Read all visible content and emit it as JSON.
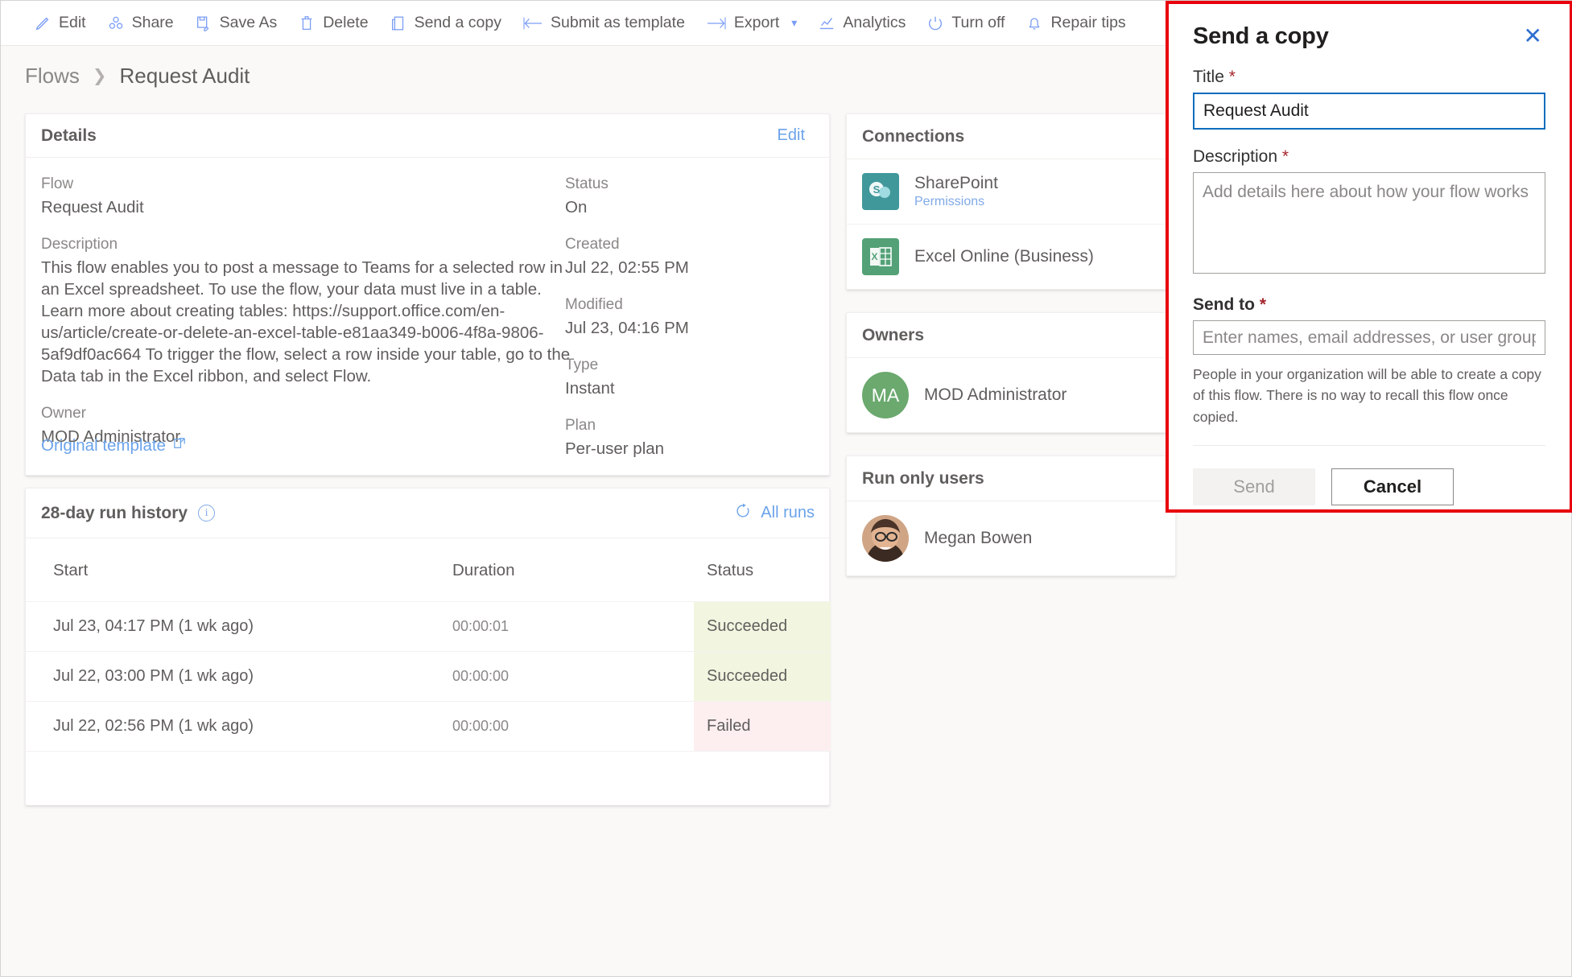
{
  "commandbar": {
    "items": [
      {
        "label": "Edit",
        "icon": "pencil-icon",
        "has_chevron": false
      },
      {
        "label": "Share",
        "icon": "share-icon",
        "has_chevron": false
      },
      {
        "label": "Save As",
        "icon": "save-as-icon",
        "has_chevron": false
      },
      {
        "label": "Delete",
        "icon": "trash-icon",
        "has_chevron": false
      },
      {
        "label": "Send a copy",
        "icon": "send-copy-icon",
        "has_chevron": false
      },
      {
        "label": "Submit as template",
        "icon": "submit-arrow-icon",
        "has_chevron": false
      },
      {
        "label": "Export",
        "icon": "export-arrow-icon",
        "has_chevron": true
      },
      {
        "label": "Analytics",
        "icon": "analytics-icon",
        "has_chevron": false
      },
      {
        "label": "Turn off",
        "icon": "power-icon",
        "has_chevron": false
      },
      {
        "label": "Repair tips",
        "icon": "bell-icon",
        "has_chevron": false
      }
    ]
  },
  "breadcrumb": {
    "parent": "Flows",
    "separator": "❯",
    "current": "Request Audit"
  },
  "details": {
    "title": "Details",
    "edit_label": "Edit",
    "left_fields": [
      {
        "label": "Flow",
        "value": "Request Audit"
      },
      {
        "label": "Description",
        "value": "This flow enables you to post a message to Teams for a selected row in an Excel spreadsheet. To use the flow, your data must live in a table. Learn more about creating tables: https://support.office.com/en-us/article/create-or-delete-an-excel-table-e81aa349-b006-4f8a-9806-5af9df0ac664 To trigger the flow, select a row inside your table, go to the Data tab in the Excel ribbon, and select Flow."
      },
      {
        "label": "Owner",
        "value": "MOD Administrator"
      }
    ],
    "right_fields": [
      {
        "label": "Status",
        "value": "On"
      },
      {
        "label": "Created",
        "value": "Jul 22, 02:55 PM"
      },
      {
        "label": "Modified",
        "value": "Jul 23, 04:16 PM"
      },
      {
        "label": "Type",
        "value": "Instant"
      },
      {
        "label": "Plan",
        "value": "Per-user plan"
      }
    ],
    "original_template_label": "Original template"
  },
  "run_history": {
    "title": "28-day run history",
    "info_glyph": "i",
    "all_runs_label": "All runs",
    "columns": [
      "Start",
      "Duration",
      "Status"
    ],
    "rows": [
      {
        "start": "Jul 23, 04:17 PM (1 wk ago)",
        "duration": "00:00:01",
        "status": "Succeeded",
        "status_kind": "succeeded"
      },
      {
        "start": "Jul 22, 03:00 PM (1 wk ago)",
        "duration": "00:00:00",
        "status": "Succeeded",
        "status_kind": "succeeded"
      },
      {
        "start": "Jul 22, 02:56 PM (1 wk ago)",
        "duration": "00:00:00",
        "status": "Failed",
        "status_kind": "failed"
      }
    ]
  },
  "rail": {
    "connections": {
      "title": "Connections",
      "items": [
        {
          "name": "SharePoint",
          "sub": "Permissions",
          "icon": "sharepoint-icon",
          "color": "#41989b"
        },
        {
          "name": "Excel Online (Business)",
          "sub": "",
          "icon": "excel-icon",
          "color": "#54a177"
        }
      ]
    },
    "owners": {
      "title": "Owners",
      "items": [
        {
          "name": "MOD Administrator",
          "initials": "MA",
          "avatar": "initials-avatar",
          "color": "#6ba96e"
        }
      ]
    },
    "run_only_users": {
      "title": "Run only users",
      "items": [
        {
          "name": "Megan Bowen",
          "avatar": "photo-avatar"
        }
      ]
    }
  },
  "panel": {
    "title": "Send a copy",
    "close_glyph": "✕",
    "title_field": {
      "label": "Title",
      "required_mark": "*",
      "value": "Request Audit"
    },
    "description_field": {
      "label": "Description",
      "required_mark": "*",
      "value": "",
      "placeholder": "Add details here about how your flow works"
    },
    "sendto_field": {
      "label": "Send to",
      "required_mark": "*",
      "value": "",
      "placeholder": "Enter names, email addresses, or user groups"
    },
    "helper_text": "People in your organization will be able to create a copy of this flow. There is no way to recall this flow once copied.",
    "send_label": "Send",
    "cancel_label": "Cancel",
    "highlight_color": "#e8000d",
    "focus_color": "#0f6cbd"
  }
}
